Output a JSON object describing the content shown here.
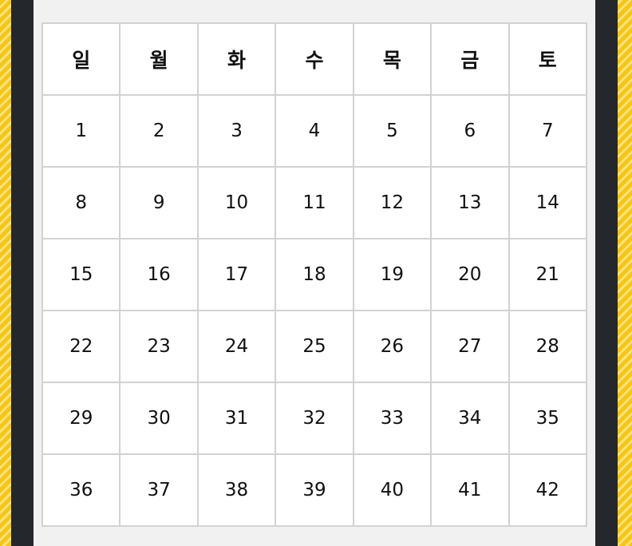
{
  "calendar": {
    "weekdays": [
      "일",
      "월",
      "화",
      "수",
      "목",
      "금",
      "토"
    ],
    "weeks": [
      [
        "1",
        "2",
        "3",
        "4",
        "5",
        "6",
        "7"
      ],
      [
        "8",
        "9",
        "10",
        "11",
        "12",
        "13",
        "14"
      ],
      [
        "15",
        "16",
        "17",
        "18",
        "19",
        "20",
        "21"
      ],
      [
        "22",
        "23",
        "24",
        "25",
        "26",
        "27",
        "28"
      ],
      [
        "29",
        "30",
        "31",
        "32",
        "33",
        "34",
        "35"
      ],
      [
        "36",
        "37",
        "38",
        "39",
        "40",
        "41",
        "42"
      ]
    ]
  },
  "colors": {
    "background_stripe": "#f5c518",
    "frame": "#24272b",
    "panel": "#f1f1f1",
    "grid_line": "#d2d2d2",
    "text": "#111111"
  }
}
